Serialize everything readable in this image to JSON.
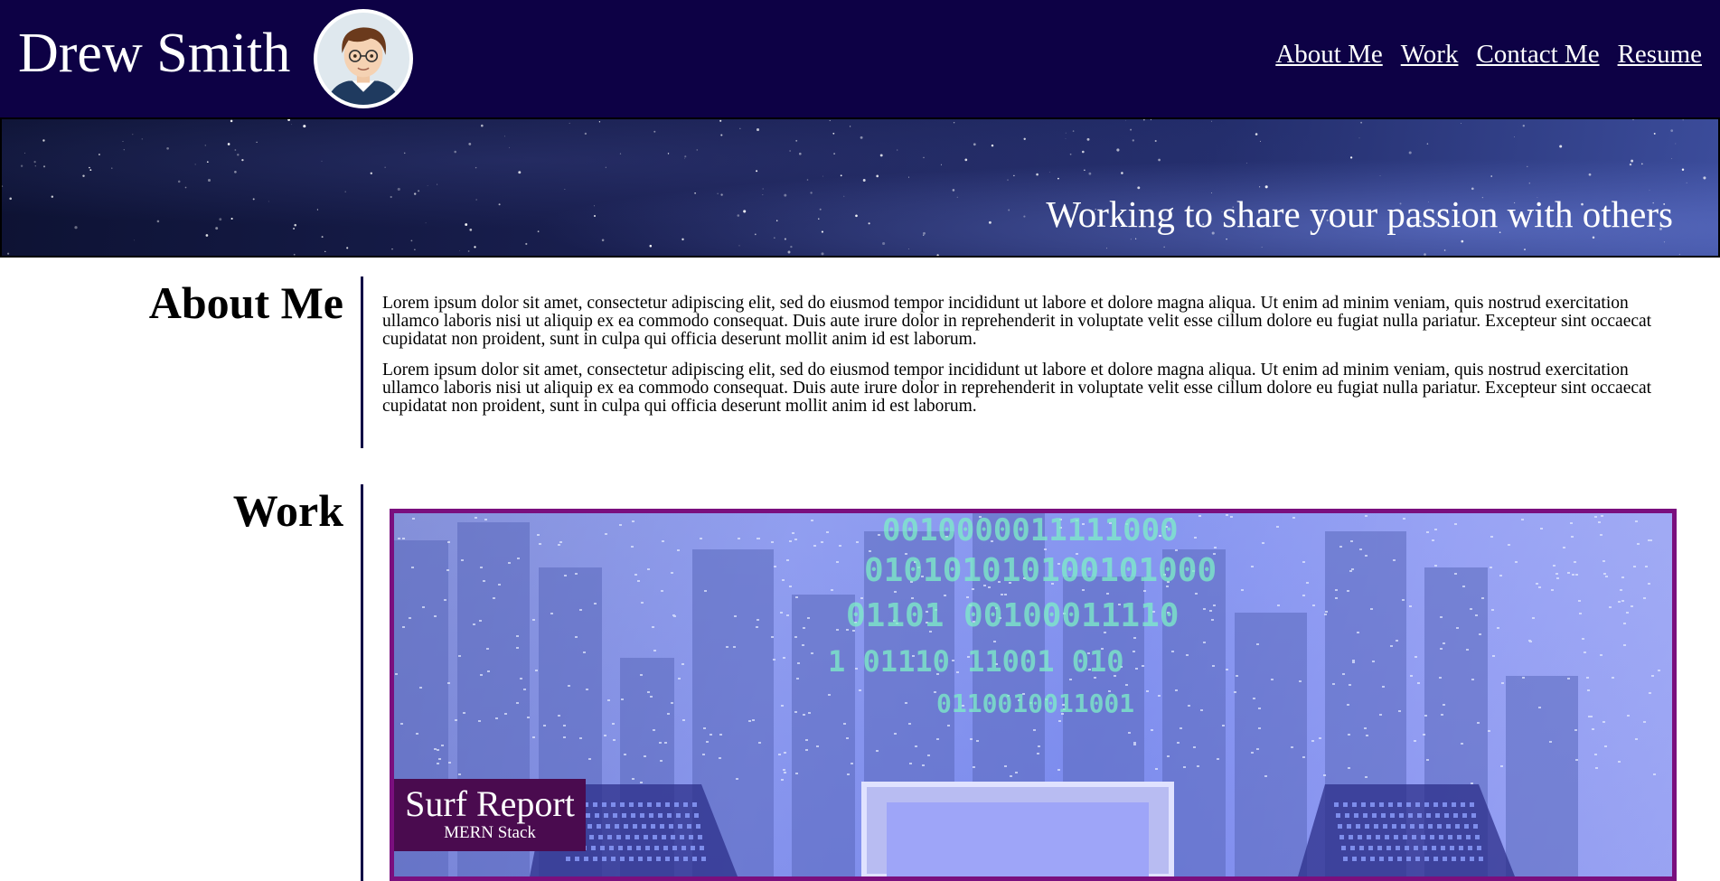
{
  "header": {
    "name": "Drew Smith",
    "nav": [
      "About Me",
      "Work",
      "Contact Me",
      "Resume"
    ]
  },
  "hero": {
    "tagline": "Working to share your passion with others"
  },
  "about": {
    "title": "About Me",
    "paragraphs": [
      "Lorem ipsum dolor sit amet, consectetur adipiscing elit, sed do eiusmod tempor incididunt ut labore et dolore magna aliqua. Ut enim ad minim veniam, quis nostrud exercitation ullamco laboris nisi ut aliquip ex ea commodo consequat. Duis aute irure dolor in reprehenderit in voluptate velit esse cillum dolore eu fugiat nulla pariatur. Excepteur sint occaecat cupidatat non proident, sunt in culpa qui officia deserunt mollit anim id est laborum.",
      "Lorem ipsum dolor sit amet, consectetur adipiscing elit, sed do eiusmod tempor incididunt ut labore et dolore magna aliqua. Ut enim ad minim veniam, quis nostrud exercitation ullamco laboris nisi ut aliquip ex ea commodo consequat. Duis aute irure dolor in reprehenderit in voluptate velit esse cillum dolore eu fugiat nulla pariatur. Excepteur sint occaecat cupidatat non proident, sunt in culpa qui officia deserunt mollit anim id est laborum."
    ]
  },
  "work": {
    "title": "Work",
    "projects": [
      {
        "title": "Surf Report",
        "stack": "MERN Stack"
      }
    ]
  },
  "colors": {
    "header_bg": "#0d0145",
    "divider": "#0d0145",
    "card_border": "#7a0f7e",
    "card_label_bg": "#4a0b4f"
  },
  "icons": {
    "avatar": "cartoon-portrait-avatar"
  }
}
